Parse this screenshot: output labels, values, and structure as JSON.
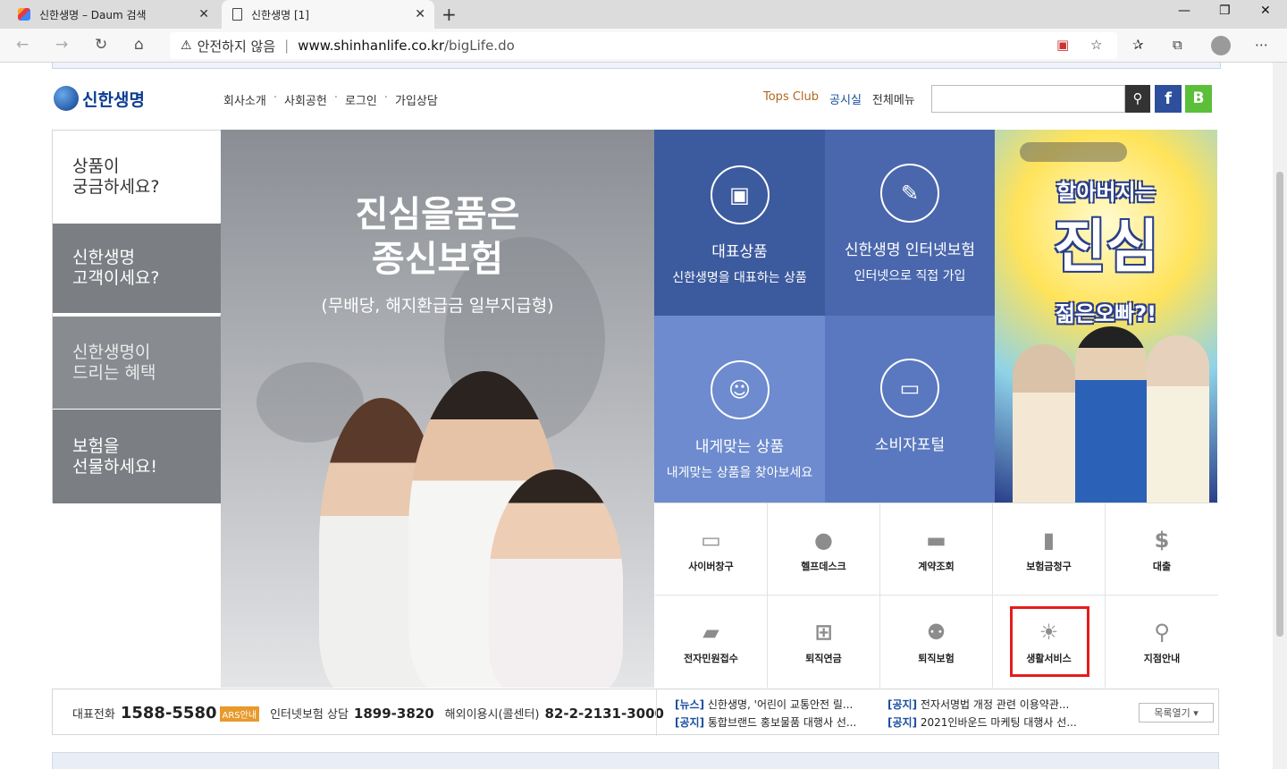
{
  "browser": {
    "tabs": [
      {
        "title": "신한생명 – Daum 검색",
        "close": "✕"
      },
      {
        "title": "신한생명 [1]",
        "close": "✕"
      }
    ],
    "new_tab": "+",
    "window_controls": [
      "—",
      "❐",
      "✕"
    ],
    "address": {
      "security": "안전하지 않음",
      "separator": "|",
      "host": "www.shinhanlife.co.kr",
      "path": "/bigLife.do"
    },
    "icons": [
      "back-icon",
      "forward-icon",
      "refresh-icon",
      "home-icon",
      "warning-icon",
      "tracking-icon",
      "favorite-add-icon",
      "favorites-icon",
      "collections-icon",
      "profile-icon",
      "more-icon"
    ]
  },
  "header": {
    "logo": "신한생명",
    "gnb": [
      "회사소개",
      "사회공헌",
      "로그인",
      "가입상담"
    ],
    "gnb_dot": "·",
    "util": {
      "tops_club": "Tops Club",
      "notice": "공시실",
      "menu": "전체메뉴"
    },
    "search_placeholder": "",
    "social": {
      "facebook": "f",
      "blog": "B"
    }
  },
  "lnb": [
    {
      "line1": "상품이",
      "line2": "궁금하세요?"
    },
    {
      "line1": "신한생명",
      "line2": "고객이세요?"
    },
    {
      "line1": "신한생명이",
      "line2": "드리는 혜택"
    },
    {
      "line1": "보험을",
      "line2": "선물하세요!"
    }
  ],
  "hero": {
    "title1": "진심을품은",
    "title2": "종신보험",
    "subtitle": "(무배당, 해지환급금 일부지급형)"
  },
  "tiles": [
    {
      "title": "대표상품",
      "sub": "신한생명을 대표하는 상품",
      "icon": "bag-icon"
    },
    {
      "title": "신한생명 인터넷보험",
      "sub": "인터넷으로 직접 가입",
      "icon": "document-icon"
    },
    {
      "title": "내게맞는 상품",
      "sub": "내게맞는 상품을 찾아보세요",
      "icon": "user-icon"
    },
    {
      "title": "소비자포털",
      "sub": "",
      "icon": "monitor-icon"
    }
  ],
  "banner": {
    "line1": "할아버지는",
    "line2": "진심",
    "line3": "젊은오빠?!"
  },
  "quick": [
    {
      "label": "사이버창구",
      "icon": "computer-icon"
    },
    {
      "label": "헬프데스크",
      "icon": "microphone-icon"
    },
    {
      "label": "계약조회",
      "icon": "inbox-icon"
    },
    {
      "label": "보험금청구",
      "icon": "mouse-icon"
    },
    {
      "label": "대출",
      "icon": "coin-icon"
    },
    {
      "label": "전자민원접수",
      "icon": "folder-icon"
    },
    {
      "label": "퇴직연금",
      "icon": "presentation-icon"
    },
    {
      "label": "퇴직보험",
      "icon": "people-icon"
    },
    {
      "label": "생활서비스",
      "icon": "lightbulb-icon"
    },
    {
      "label": "지점안내",
      "icon": "location-pin-icon"
    }
  ],
  "contact": {
    "main_label": "대표전화",
    "main_number": "1588-5580",
    "ars": "ARS안내",
    "internet_label": "인터넷보험 상담",
    "internet_number": "1899-3820",
    "overseas_label": "해외이용시(콜센터)",
    "overseas_number": "82-2-2131-3000"
  },
  "news": [
    {
      "tag": "[뉴스]",
      "text": "신한생명, '어린이 교통안전 릴..."
    },
    {
      "tag": "[공지]",
      "text": "전자서명법 개정 관련 이용약관..."
    },
    {
      "tag": "[공지]",
      "text": "통합브랜드 홍보물품 대행사 선..."
    },
    {
      "tag": "[공지]",
      "text": "2021인바운드 마케팅 대행사 선..."
    }
  ],
  "more_button": "목록열기",
  "colors": {
    "tile_dark": "#3c5a9e",
    "tile_mid": "#4a67ad",
    "tile_light": "#6d8bce",
    "highlight": "#e51c1c",
    "lnb_gray": "#7b7e82"
  }
}
